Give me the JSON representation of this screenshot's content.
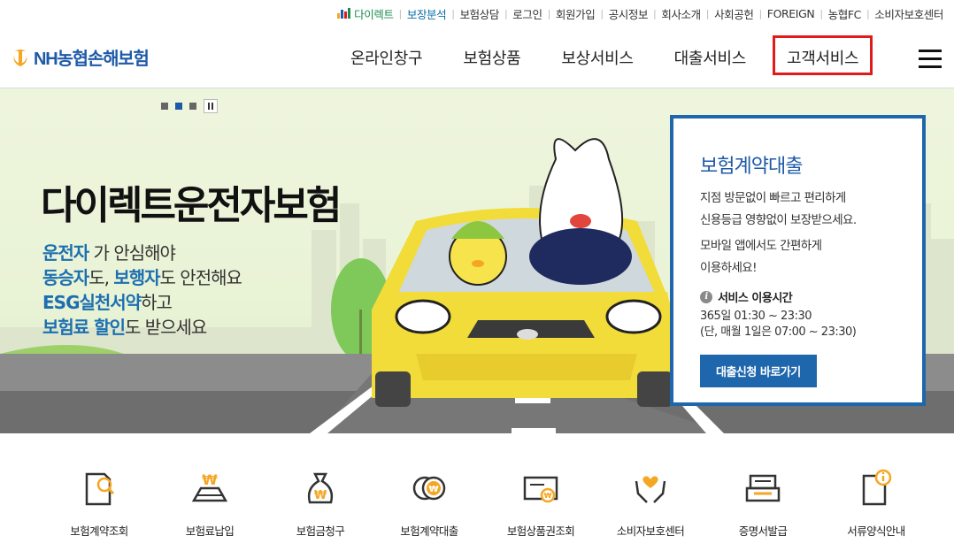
{
  "util_links": [
    {
      "label": "다이렉트",
      "style": "green",
      "icon": "bar-chart-icon"
    },
    {
      "label": "보장분석",
      "style": "blue"
    },
    {
      "label": "보험상담"
    },
    {
      "label": "로그인"
    },
    {
      "label": "회원가입"
    },
    {
      "label": "공시정보"
    },
    {
      "label": "회사소개"
    },
    {
      "label": "사회공헌"
    },
    {
      "label": "FOREIGN"
    },
    {
      "label": "농협FC"
    },
    {
      "label": "소비자보호센터"
    }
  ],
  "logo": {
    "text": "NH농협손해보험",
    "icon": "nh-logo-icon"
  },
  "gnb": {
    "items": [
      "온라인창구",
      "보험상품",
      "보상서비스",
      "대출서비스",
      "고객서비스"
    ],
    "highlighted": "고객서비스"
  },
  "banner": {
    "headline": "다이렉트운전자보험",
    "copy": [
      [
        {
          "t": "운전자",
          "hl": true
        },
        {
          "t": " 가 안심해야"
        }
      ],
      [
        {
          "t": "동승자",
          "hl": true
        },
        {
          "t": "도, "
        },
        {
          "t": "보행자",
          "hl": true
        },
        {
          "t": "도 안전해요"
        }
      ],
      [
        {
          "t": "ESG실천서약",
          "hl": true
        },
        {
          "t": "하고"
        }
      ],
      [
        {
          "t": "보험료 할인",
          "hl": true
        },
        {
          "t": "도 받으세요"
        }
      ]
    ],
    "slides": {
      "count": 3,
      "active": 1
    }
  },
  "card": {
    "title": "보험계약대출",
    "desc1": [
      "지점 방문없이 빠르고 편리하게",
      "신용등급 영향없이 보장받으세요."
    ],
    "desc2": [
      "모바일 앱에서도 간편하게",
      "이용하세요!"
    ],
    "service_label": "서비스 이용시간",
    "hours": [
      "365일 01:30 ~ 23:30",
      "(단, 매월 1일은 07:00 ~ 23:30)"
    ],
    "button": "대출신청 바로가기"
  },
  "quick_menu": [
    {
      "label": "보험계약조회",
      "icon": "document-search-icon"
    },
    {
      "label": "보험료납입",
      "icon": "won-payment-icon"
    },
    {
      "label": "보험금청구",
      "icon": "money-bag-icon"
    },
    {
      "label": "보험계약대출",
      "icon": "coins-icon"
    },
    {
      "label": "보험상품권조회",
      "icon": "voucher-icon"
    },
    {
      "label": "소비자보호센터",
      "icon": "hands-heart-icon"
    },
    {
      "label": "증명서발급",
      "icon": "printer-icon"
    },
    {
      "label": "서류양식안내",
      "icon": "document-info-icon"
    }
  ],
  "colors": {
    "brand_blue": "#1e5aa7",
    "accent_yellow": "#f5a623",
    "highlight_red": "#e01b1b"
  }
}
